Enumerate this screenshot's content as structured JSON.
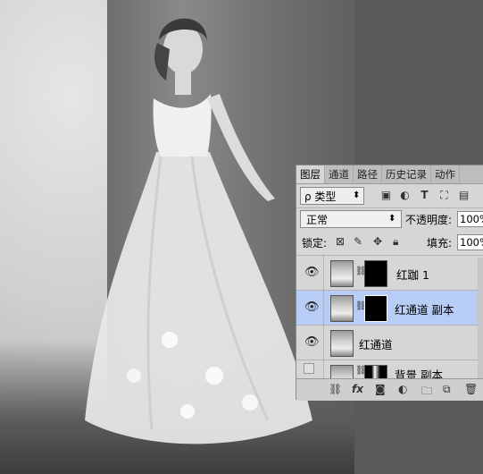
{
  "panel": {
    "tabs": [
      "图层",
      "通道",
      "路径",
      "历史记录",
      "动作"
    ],
    "filter": {
      "label": "ρ 类型",
      "arrows": "⬍"
    },
    "blend_mode": "正常",
    "opacity_label": "不透明度:",
    "opacity_value": "100%",
    "lock_label": "锁定:",
    "fill_label": "填充:",
    "fill_value": "100%",
    "layers": [
      {
        "name": "红跏 1",
        "visible": true,
        "selected": false
      },
      {
        "name": "红通道 副本",
        "visible": true,
        "selected": true
      },
      {
        "name": "红通道",
        "visible": true,
        "selected": false
      },
      {
        "name": "背景 副本",
        "visible": false,
        "selected": false
      }
    ],
    "bottom_icons": [
      "link-icon",
      "fx-icon",
      "mask-icon",
      "adjustment-icon",
      "folder-icon",
      "new-layer-icon",
      "trash-icon"
    ],
    "fx_label": "fx"
  },
  "colors": {
    "selection": "#b7cdf6",
    "panel_bg": "#d6d6d6"
  }
}
